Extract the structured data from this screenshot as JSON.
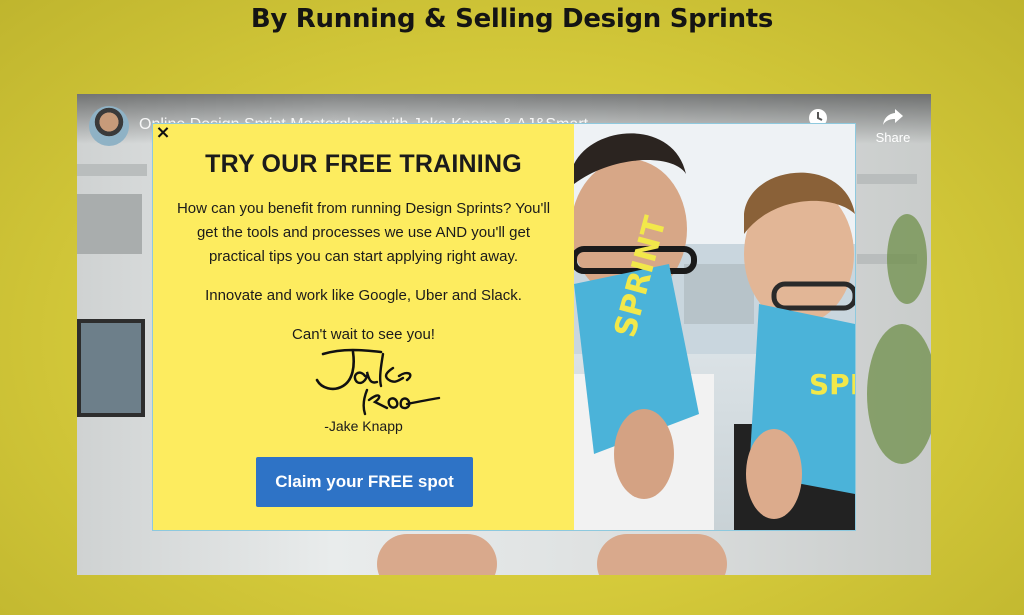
{
  "page": {
    "heading": "By Running & Selling Design Sprints"
  },
  "video": {
    "title": "Online Design Sprint Masterclass with Jake Knapp & AJ&Smart",
    "share_label": "Share",
    "icons": {
      "watch_later": "clock-icon",
      "share": "share-arrow-icon"
    }
  },
  "modal": {
    "close_label": "×",
    "heading": "TRY OUR FREE TRAINING",
    "paragraphs": [
      "How can you benefit from running Design Sprints? You'll get the tools and processes we use AND you'll get practical tips you can start applying right away.",
      "Innovate and work like Google, Uber and Slack.",
      "Can't wait to see you!"
    ],
    "signature_text": "Jake Knapp",
    "signature_name": "-Jake Knapp",
    "cta_label": "Claim your FREE spot",
    "book_cover_text": "SPRINT"
  },
  "colors": {
    "page_background": "#d4c93a",
    "modal_left_background": "#fdec5f",
    "cta_background": "#2e73c6",
    "modal_border": "#8ec9de",
    "book_cover": "#4bb3d9"
  }
}
